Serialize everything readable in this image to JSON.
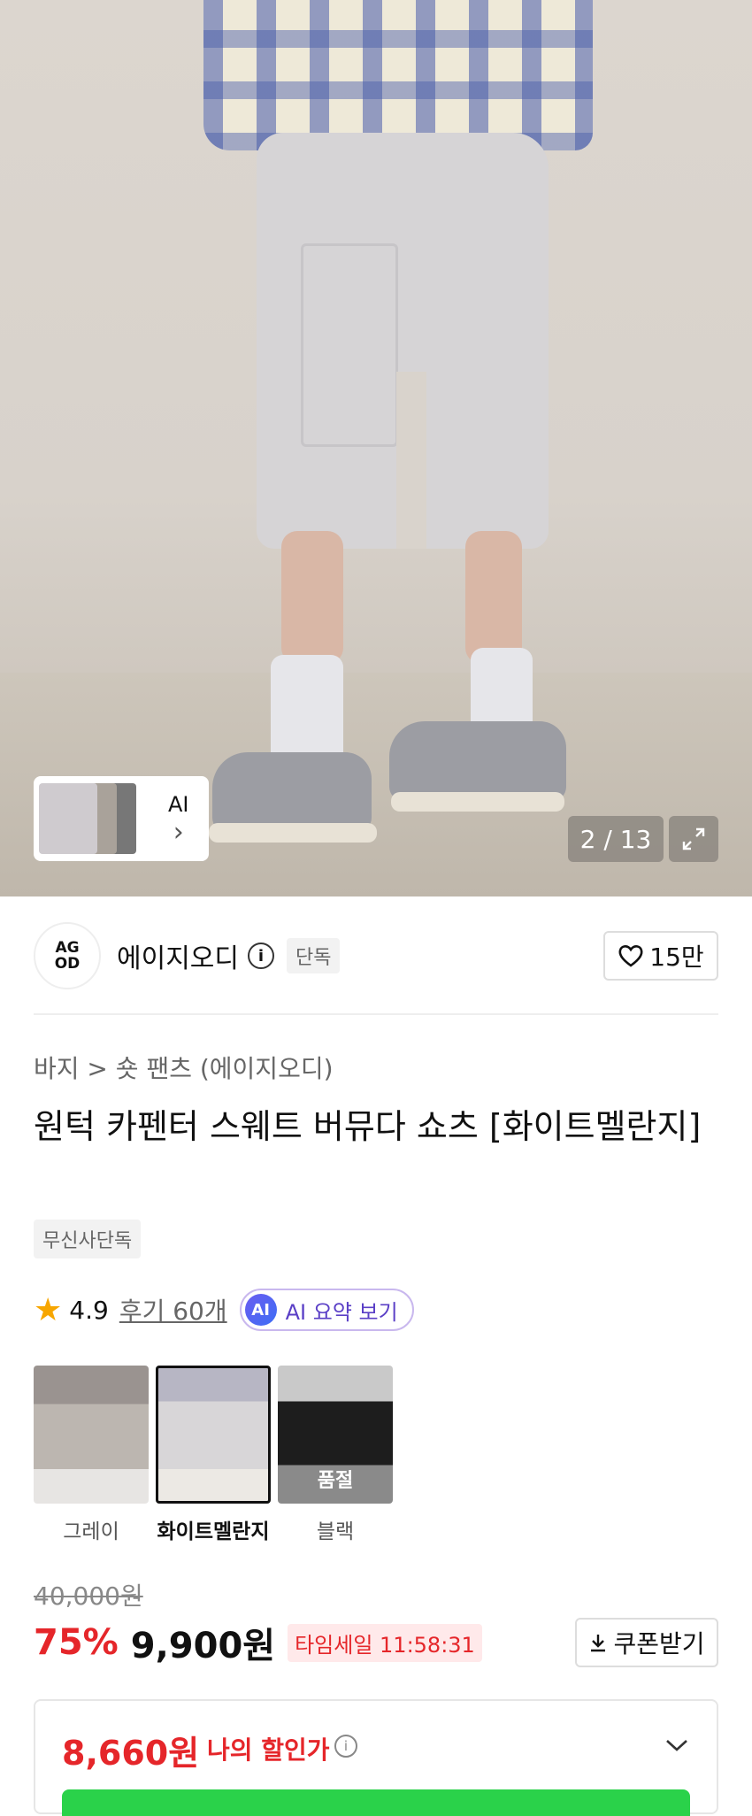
{
  "gallery": {
    "counter": "2 / 13",
    "thumb_ai_label": "AI",
    "thumb_ai_arrow": "›"
  },
  "brand": {
    "logo_text": "AG OD",
    "name": "에이지오디",
    "badge": "단독",
    "like_count": "15만"
  },
  "product": {
    "breadcrumb": "바지 > 숏 팬츠 (에이지오디)",
    "title": "원턱 카펜터 스웨트 버뮤다 쇼츠 [화이트멜란지]",
    "tag": "무신사단독",
    "rating": "4.9",
    "reviews": "후기 60개",
    "ai_summary": "AI 요약 보기",
    "ai_badge": "AI"
  },
  "options": [
    {
      "label": "그레이",
      "selected": false,
      "soldout": ""
    },
    {
      "label": "화이트멜란지",
      "selected": true,
      "soldout": ""
    },
    {
      "label": "블랙",
      "selected": false,
      "soldout": "품절"
    }
  ],
  "pricing": {
    "original": "40,000원",
    "discount": "75%",
    "price": "9,900원",
    "timesale": "타임세일 11:58:31",
    "coupon": "쿠폰받기",
    "my_price": "8,660원",
    "my_label": "나의 할인가",
    "info": "i"
  },
  "colors": {
    "accent_red": "#e5262a",
    "ai_purple": "#5a3fc6",
    "green": "#2ad24a"
  }
}
